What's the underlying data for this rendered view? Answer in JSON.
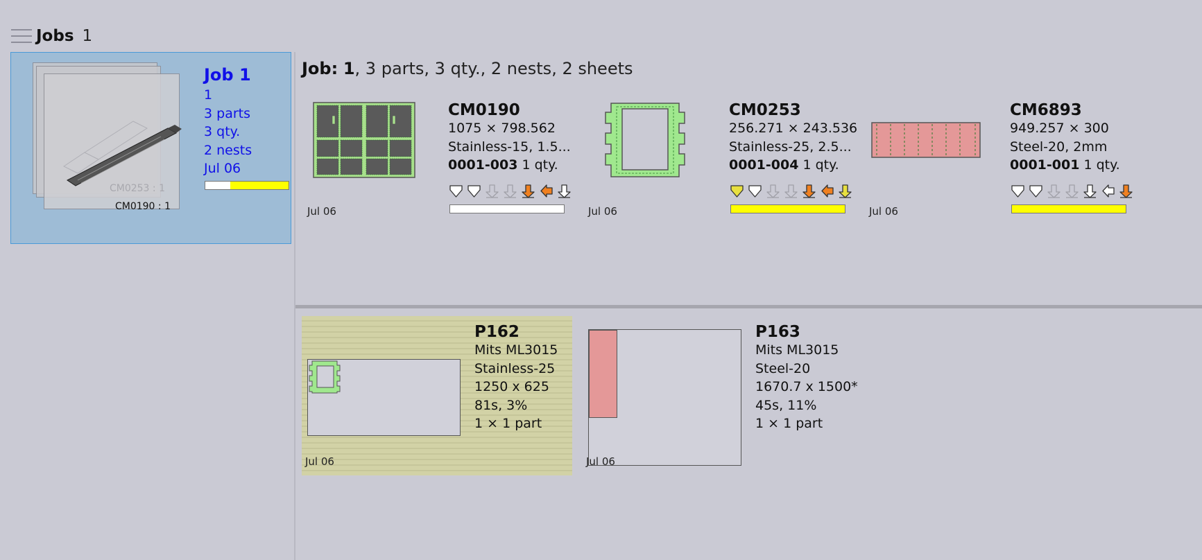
{
  "header": {
    "title": "Jobs",
    "count": "1"
  },
  "job_card": {
    "thumb_label_faded": "CM0253 : 1",
    "thumb_label": "CM0190 : 1",
    "title": "Job 1",
    "lines": [
      "1",
      "3 parts",
      "3 qty.",
      "2 nests",
      "Jul 06"
    ],
    "progress_pct": 70
  },
  "job_summary": {
    "label": "Job:",
    "value": "1",
    "rest": ", 3 parts, 3 qty., 2 nests, 2 sheets"
  },
  "parts": [
    {
      "name": "CM0190",
      "dims": "1075 × 798.562",
      "material": "Stainless-15, 1.5...",
      "code": "0001-003",
      "qty": "1 qty.",
      "date": "Jul 06",
      "bar_color": "#ffffff",
      "icons": [
        "cut-outline-icon",
        "cut-outline-icon",
        "down-grey-icon",
        "down-grey-icon",
        "down-orange-icon",
        "left-orange-icon",
        "down-outline-icon"
      ]
    },
    {
      "name": "CM0253",
      "dims": "256.271 × 243.536",
      "material": "Stainless-25, 2.5...",
      "code": "0001-004",
      "qty": "1 qty.",
      "date": "Jul 06",
      "bar_color": "#ffff00",
      "icons": [
        "cut-yellow-icon",
        "cut-outline-icon",
        "down-grey-icon",
        "down-grey-icon",
        "down-orange-icon",
        "left-orange-icon",
        "down-yellow-icon"
      ]
    },
    {
      "name": "CM6893",
      "dims": "949.257 × 300",
      "material": "Steel-20, 2mm",
      "code": "0001-001",
      "qty": "1 qty.",
      "date": "Jul 06",
      "bar_color": "#ffff00",
      "icons": [
        "cut-outline-icon",
        "cut-outline-icon",
        "down-grey-icon",
        "down-grey-icon",
        "down-outline-icon",
        "left-outline-icon",
        "down-orange-icon"
      ]
    }
  ],
  "nests": [
    {
      "name": "P162",
      "machine": "Mits ML3015",
      "material": "Stainless-25",
      "size": "1250 x 625",
      "time": "81s, 3%",
      "count": "1 × 1 part",
      "date": "Jul 06"
    },
    {
      "name": "P163",
      "machine": "Mits ML3015",
      "material": "Steel-20",
      "size": "1670.7 x 1500*",
      "time": "45s, 11%",
      "count": "1 × 1 part",
      "date": "Jul 06"
    }
  ]
}
